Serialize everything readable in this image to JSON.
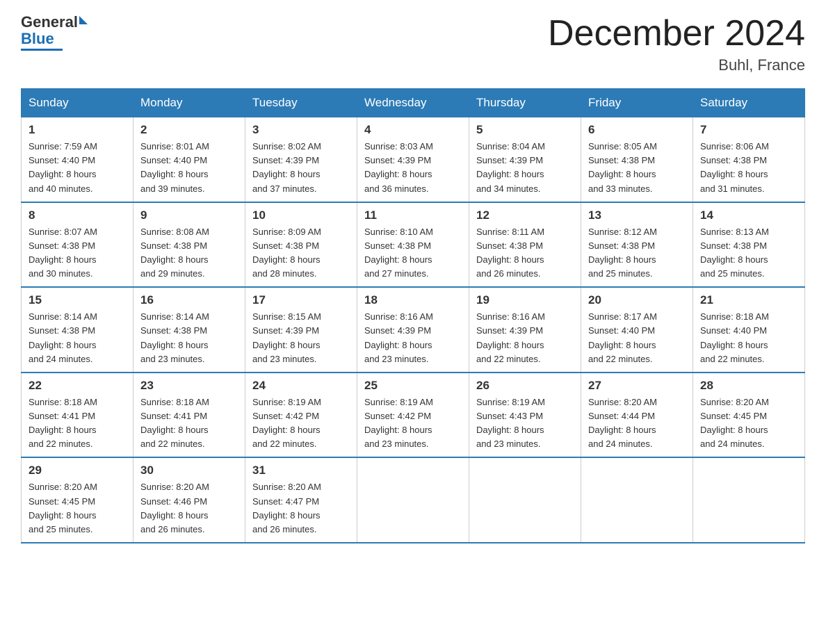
{
  "header": {
    "logo_general": "General",
    "logo_blue": "Blue",
    "main_title": "December 2024",
    "subtitle": "Buhl, France"
  },
  "days_of_week": [
    "Sunday",
    "Monday",
    "Tuesday",
    "Wednesday",
    "Thursday",
    "Friday",
    "Saturday"
  ],
  "weeks": [
    [
      {
        "day": 1,
        "sunrise": "7:59 AM",
        "sunset": "4:40 PM",
        "daylight": "8 hours and 40 minutes."
      },
      {
        "day": 2,
        "sunrise": "8:01 AM",
        "sunset": "4:40 PM",
        "daylight": "8 hours and 39 minutes."
      },
      {
        "day": 3,
        "sunrise": "8:02 AM",
        "sunset": "4:39 PM",
        "daylight": "8 hours and 37 minutes."
      },
      {
        "day": 4,
        "sunrise": "8:03 AM",
        "sunset": "4:39 PM",
        "daylight": "8 hours and 36 minutes."
      },
      {
        "day": 5,
        "sunrise": "8:04 AM",
        "sunset": "4:39 PM",
        "daylight": "8 hours and 34 minutes."
      },
      {
        "day": 6,
        "sunrise": "8:05 AM",
        "sunset": "4:38 PM",
        "daylight": "8 hours and 33 minutes."
      },
      {
        "day": 7,
        "sunrise": "8:06 AM",
        "sunset": "4:38 PM",
        "daylight": "8 hours and 31 minutes."
      }
    ],
    [
      {
        "day": 8,
        "sunrise": "8:07 AM",
        "sunset": "4:38 PM",
        "daylight": "8 hours and 30 minutes."
      },
      {
        "day": 9,
        "sunrise": "8:08 AM",
        "sunset": "4:38 PM",
        "daylight": "8 hours and 29 minutes."
      },
      {
        "day": 10,
        "sunrise": "8:09 AM",
        "sunset": "4:38 PM",
        "daylight": "8 hours and 28 minutes."
      },
      {
        "day": 11,
        "sunrise": "8:10 AM",
        "sunset": "4:38 PM",
        "daylight": "8 hours and 27 minutes."
      },
      {
        "day": 12,
        "sunrise": "8:11 AM",
        "sunset": "4:38 PM",
        "daylight": "8 hours and 26 minutes."
      },
      {
        "day": 13,
        "sunrise": "8:12 AM",
        "sunset": "4:38 PM",
        "daylight": "8 hours and 25 minutes."
      },
      {
        "day": 14,
        "sunrise": "8:13 AM",
        "sunset": "4:38 PM",
        "daylight": "8 hours and 25 minutes."
      }
    ],
    [
      {
        "day": 15,
        "sunrise": "8:14 AM",
        "sunset": "4:38 PM",
        "daylight": "8 hours and 24 minutes."
      },
      {
        "day": 16,
        "sunrise": "8:14 AM",
        "sunset": "4:38 PM",
        "daylight": "8 hours and 23 minutes."
      },
      {
        "day": 17,
        "sunrise": "8:15 AM",
        "sunset": "4:39 PM",
        "daylight": "8 hours and 23 minutes."
      },
      {
        "day": 18,
        "sunrise": "8:16 AM",
        "sunset": "4:39 PM",
        "daylight": "8 hours and 23 minutes."
      },
      {
        "day": 19,
        "sunrise": "8:16 AM",
        "sunset": "4:39 PM",
        "daylight": "8 hours and 22 minutes."
      },
      {
        "day": 20,
        "sunrise": "8:17 AM",
        "sunset": "4:40 PM",
        "daylight": "8 hours and 22 minutes."
      },
      {
        "day": 21,
        "sunrise": "8:18 AM",
        "sunset": "4:40 PM",
        "daylight": "8 hours and 22 minutes."
      }
    ],
    [
      {
        "day": 22,
        "sunrise": "8:18 AM",
        "sunset": "4:41 PM",
        "daylight": "8 hours and 22 minutes."
      },
      {
        "day": 23,
        "sunrise": "8:18 AM",
        "sunset": "4:41 PM",
        "daylight": "8 hours and 22 minutes."
      },
      {
        "day": 24,
        "sunrise": "8:19 AM",
        "sunset": "4:42 PM",
        "daylight": "8 hours and 22 minutes."
      },
      {
        "day": 25,
        "sunrise": "8:19 AM",
        "sunset": "4:42 PM",
        "daylight": "8 hours and 23 minutes."
      },
      {
        "day": 26,
        "sunrise": "8:19 AM",
        "sunset": "4:43 PM",
        "daylight": "8 hours and 23 minutes."
      },
      {
        "day": 27,
        "sunrise": "8:20 AM",
        "sunset": "4:44 PM",
        "daylight": "8 hours and 24 minutes."
      },
      {
        "day": 28,
        "sunrise": "8:20 AM",
        "sunset": "4:45 PM",
        "daylight": "8 hours and 24 minutes."
      }
    ],
    [
      {
        "day": 29,
        "sunrise": "8:20 AM",
        "sunset": "4:45 PM",
        "daylight": "8 hours and 25 minutes."
      },
      {
        "day": 30,
        "sunrise": "8:20 AM",
        "sunset": "4:46 PM",
        "daylight": "8 hours and 26 minutes."
      },
      {
        "day": 31,
        "sunrise": "8:20 AM",
        "sunset": "4:47 PM",
        "daylight": "8 hours and 26 minutes."
      },
      null,
      null,
      null,
      null
    ]
  ],
  "labels": {
    "sunrise": "Sunrise:",
    "sunset": "Sunset:",
    "daylight": "Daylight:"
  }
}
